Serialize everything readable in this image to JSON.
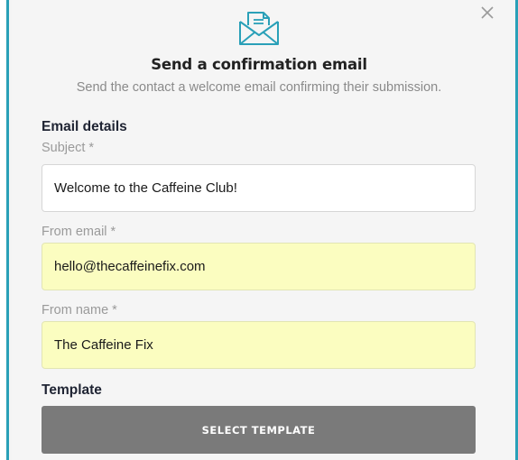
{
  "dialog": {
    "title": "Send a confirmation email",
    "subtitle": "Send the contact a welcome email confirming their submission.",
    "close_icon": "close-icon",
    "header_icon": "envelope-letter-icon"
  },
  "email_details": {
    "heading": "Email details",
    "subject": {
      "label": "Subject *",
      "value": "Welcome to the Caffeine Club!"
    },
    "from_email": {
      "label": "From email *",
      "value": "hello@thecaffeinefix.com"
    },
    "from_name": {
      "label": "From name *",
      "value": "The Caffeine Fix"
    }
  },
  "template": {
    "heading": "Template",
    "button_label": "SELECT TEMPLATE"
  },
  "colors": {
    "accent": "#2aa0b8",
    "autofill_bg": "#fbfdc0",
    "button_bg": "#7a7a7a"
  }
}
